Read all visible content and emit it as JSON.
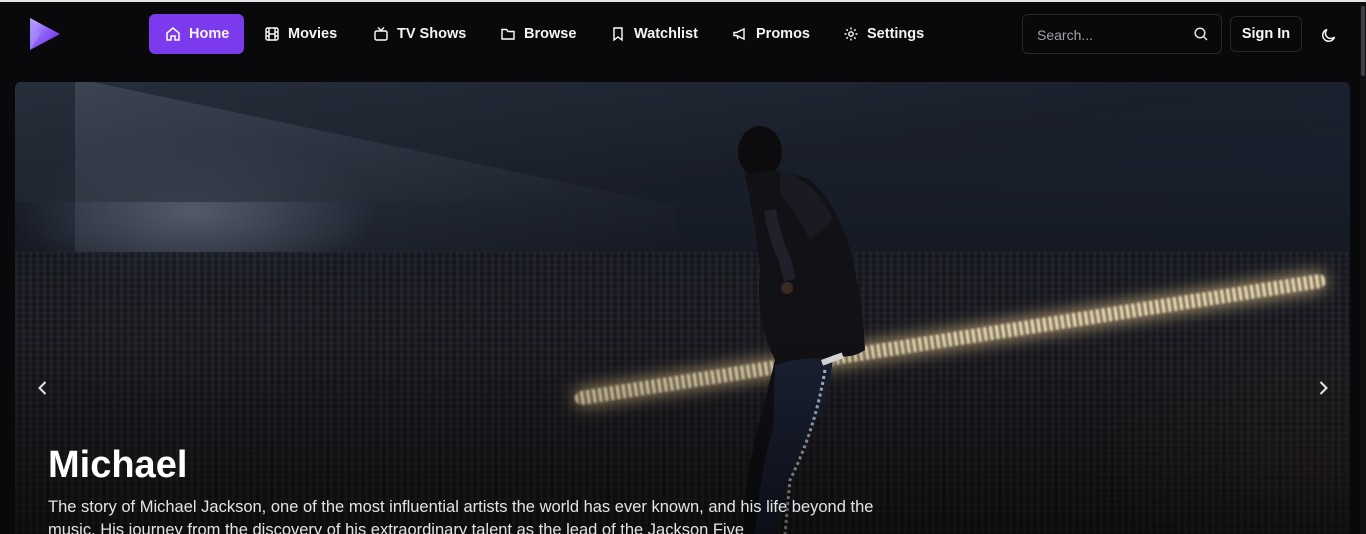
{
  "colors": {
    "accent": "#7c3aed",
    "background": "#09090b",
    "border": "#27272a"
  },
  "nav": {
    "logo_icon": "play-triangle-logo",
    "items": [
      {
        "label": "Home",
        "icon": "home-icon",
        "active": true
      },
      {
        "label": "Movies",
        "icon": "film-icon",
        "active": false
      },
      {
        "label": "TV Shows",
        "icon": "tv-icon",
        "active": false
      },
      {
        "label": "Browse",
        "icon": "folder-icon",
        "active": false
      },
      {
        "label": "Watchlist",
        "icon": "bookmark-icon",
        "active": false
      },
      {
        "label": "Promos",
        "icon": "megaphone-icon",
        "active": false
      },
      {
        "label": "Settings",
        "icon": "gear-icon",
        "active": false
      }
    ],
    "search_placeholder": "Search...",
    "sign_in_label": "Sign In",
    "theme_icon": "moon-icon"
  },
  "hero": {
    "title": "Michael",
    "description": "The story of Michael Jackson, one of the most influential artists the world has ever known, and his life beyond the music. His journey from the discovery of his extraordinary talent as the lead of the Jackson Five",
    "prev_icon": "chevron-left-icon",
    "next_icon": "chevron-right-icon"
  }
}
